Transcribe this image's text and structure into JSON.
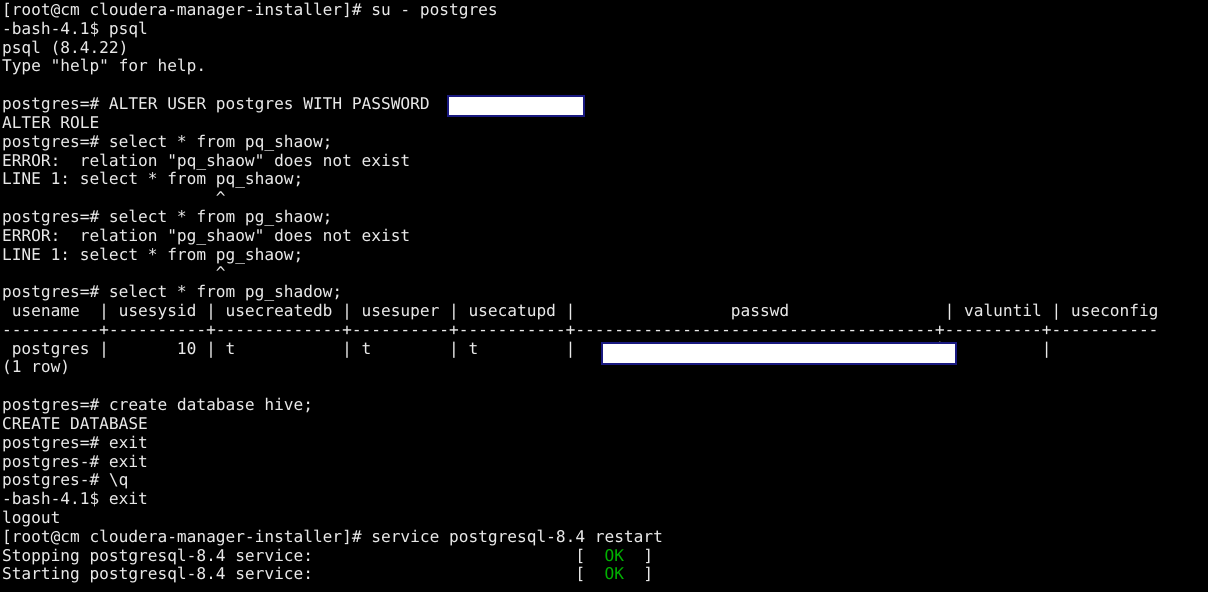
{
  "terminal": {
    "title": "root@cm:~/cloudera-manager-installer",
    "background_color": "#000000",
    "foreground_color": "#e8e8e8",
    "ok_color": "#00b000",
    "redaction_fill_color": "#ffffff",
    "redaction_border_color": "#191980",
    "columns": 124,
    "rows": 31,
    "prompts": {
      "root_shell": "[root@cm cloudera-manager-installer]#",
      "bash": "-bash-4.1$",
      "psql": "postgres=#",
      "psql_continuation": "postgres-#"
    },
    "redactions": [
      {
        "name": "password-literal",
        "line": 6,
        "description": "white box covering the password literal after WITH PASSWORD"
      },
      {
        "name": "passwd-column-value",
        "line": 18,
        "description": "white box covering the md5 password hash in the passwd column"
      }
    ],
    "lines": [
      "[root@cm cloudera-manager-installer]# su - postgres",
      "-bash-4.1$ psql",
      "psql (8.4.22)",
      "Type \"help\" for help.",
      "",
      "postgres=# ALTER USER postgres WITH PASSWORD",
      "ALTER ROLE",
      "postgres=# select * from pq_shaow;",
      "ERROR:  relation \"pq_shaow\" does not exist",
      "LINE 1: select * from pq_shaow;",
      "                      ^",
      "postgres=# select * from pg_shaow;",
      "ERROR:  relation \"pg_shaow\" does not exist",
      "LINE 1: select * from pg_shaow;",
      "                      ^",
      "postgres=# select * from pg_shadow;",
      " usename  | usesysid | usecreatedb | usesuper | usecatupd |                passwd                | valuntil | useconfig",
      "----------+----------+-------------+----------+-----------+-------------------------------------+----------+-----------",
      " postgres |       10 | t           | t        | t         |                                     |          |",
      "(1 row)",
      "",
      "postgres=# create database hive;",
      "CREATE DATABASE",
      "postgres=# exit",
      "postgres-# exit",
      "postgres-# \\q",
      "-bash-4.1$ exit",
      "logout",
      "[root@cm cloudera-manager-installer]# service postgresql-8.4 restart",
      "Stopping postgresql-8.4 service:                           [  OK  ]",
      "Starting postgresql-8.4 service:                           [  OK  ]"
    ],
    "session": {
      "commands": [
        {
          "prompt": "[root@cm cloudera-manager-installer]#",
          "command": "su - postgres"
        },
        {
          "prompt": "-bash-4.1$",
          "command": "psql"
        },
        {
          "prompt": "postgres=#",
          "command": "ALTER USER postgres WITH PASSWORD"
        },
        {
          "prompt": "postgres=#",
          "command": "select * from pq_shaow;"
        },
        {
          "prompt": "postgres=#",
          "command": "select * from pg_shaow;"
        },
        {
          "prompt": "postgres=#",
          "command": "select * from pg_shadow;"
        },
        {
          "prompt": "postgres=#",
          "command": "create database hive;"
        },
        {
          "prompt": "postgres=#",
          "command": "exit"
        },
        {
          "prompt": "postgres-#",
          "command": "exit"
        },
        {
          "prompt": "postgres-#",
          "command": "\\q"
        },
        {
          "prompt": "-bash-4.1$",
          "command": "exit"
        },
        {
          "prompt": "[root@cm cloudera-manager-installer]#",
          "command": "service postgresql-8.4 restart"
        }
      ],
      "psql_banner": {
        "version_line": "psql (8.4.22)",
        "help_line": "Type \"help\" for help."
      },
      "outputs": [
        "ALTER ROLE",
        "ERROR:  relation \"pq_shaow\" does not exist",
        "ERROR:  relation \"pg_shaow\" does not exist",
        "CREATE DATABASE",
        "logout",
        "(1 row)"
      ],
      "service_status": [
        {
          "label": "Stopping postgresql-8.4 service:",
          "status": "OK"
        },
        {
          "label": "Starting postgresql-8.4 service:",
          "status": "OK"
        }
      ]
    },
    "pg_shadow_table": {
      "columns": [
        "usename",
        "usesysid",
        "usecreatedb",
        "usesuper",
        "usecatupd",
        "passwd",
        "valuntil",
        "useconfig"
      ],
      "rows": [
        {
          "usename": "postgres",
          "usesysid": "10",
          "usecreatedb": "t",
          "usesuper": "t",
          "usecatupd": "t",
          "passwd": "",
          "valuntil": "",
          "useconfig": ""
        }
      ],
      "row_count_text": "(1 row)"
    }
  }
}
